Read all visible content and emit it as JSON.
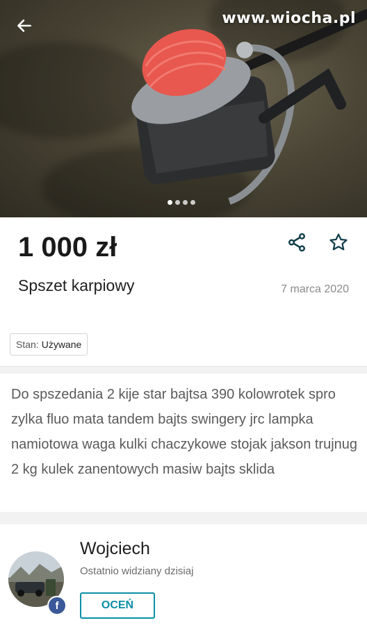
{
  "photo": {
    "watermark": "www.wiocha.pl",
    "dots_total": 4,
    "dots_active_index": 0
  },
  "listing": {
    "price": "1 000 zł",
    "title": "Spszet karpiowy",
    "date": "7 marca 2020",
    "condition_label": "Stan:",
    "condition_value": "Używane",
    "description": "Do spszedania 2 kije star bajtsa 390 kolowrotek spro zylka fluo mata tandem bajts swingery jrc lampka namiotowa waga kulki chaczykowe stojak jakson trujnug 2 kg kulek zanentowych masiw bajts sklida"
  },
  "seller": {
    "name": "Wojciech",
    "last_seen": "Ostatnio widziany dzisiaj",
    "rate_button": "OCEŃ",
    "social_badge": "f"
  },
  "icons": {
    "back": "arrow-left-icon",
    "share": "share-icon",
    "favorite": "star-outline-icon"
  },
  "colors": {
    "accent": "#0a8fa6",
    "facebook": "#3b5998"
  }
}
